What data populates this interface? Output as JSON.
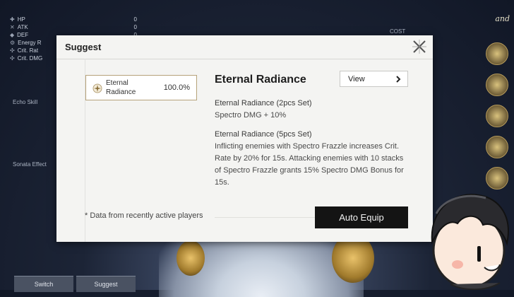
{
  "background": {
    "stats": [
      {
        "name": "HP",
        "glyph": "✚",
        "value": "0"
      },
      {
        "name": "ATK",
        "glyph": "✕",
        "value": "0"
      },
      {
        "name": "DEF",
        "glyph": "◆",
        "value": "0"
      },
      {
        "name": "Energy R",
        "glyph": "⚙",
        "value": ""
      },
      {
        "name": "Crit. Rat",
        "glyph": "✣",
        "value": ""
      },
      {
        "name": "Crit. DMG",
        "glyph": "✣",
        "value": ""
      }
    ],
    "echo_skill_label": "Echo Skill",
    "sonata_label": "Sonata Effect",
    "cost_label": "COST",
    "corner_text": "and",
    "switch_button": "Switch",
    "suggest_button": "Suggest"
  },
  "modal": {
    "title": "Suggest",
    "set_card": {
      "name": "Eternal Radiance",
      "percent": "100.0%"
    },
    "set_title": "Eternal Radiance",
    "view_label": "View",
    "effects": [
      {
        "heading": "Eternal Radiance (2pcs Set)",
        "text": "Spectro DMG + 10%"
      },
      {
        "heading": "Eternal Radiance (5pcs Set)",
        "text": "Inflicting enemies with Spectro Frazzle increases Crit. Rate by 20% for 15s. Attacking enemies with 10 stacks of Spectro Frazzle grants 15% Spectro DMG Bonus for 15s."
      }
    ],
    "footnote": "* Data from recently active players",
    "auto_equip_label": "Auto Equip"
  },
  "colors": {
    "card_border": "#b6a27a",
    "button_dark": "#141414",
    "modal_bg": "#f4f4f2"
  }
}
